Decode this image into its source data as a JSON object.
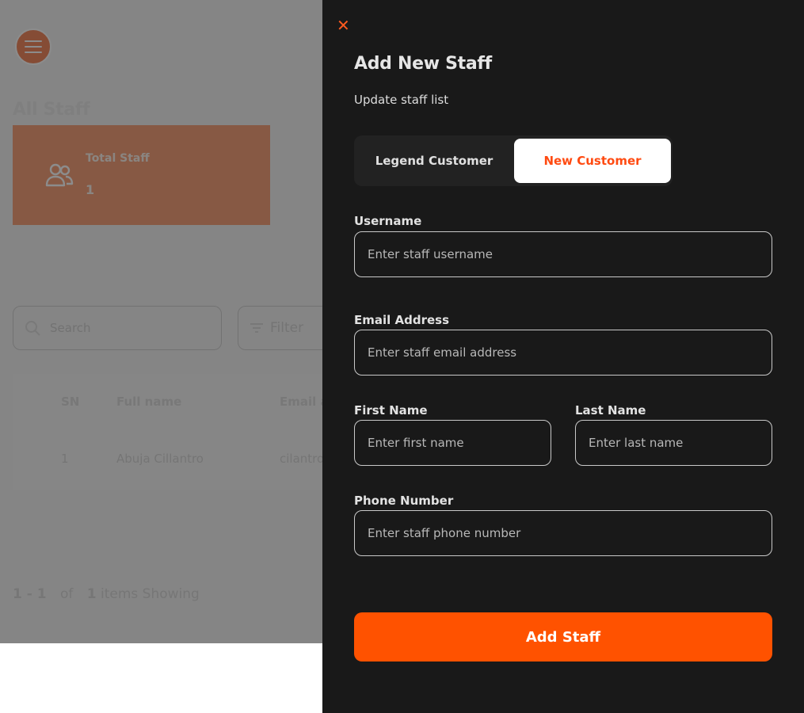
{
  "page": {
    "title": "All Staff",
    "stat": {
      "label": "Total Staff",
      "value": "1"
    },
    "search": {
      "placeholder": "Search"
    },
    "filter": {
      "label": "Filter"
    },
    "table": {
      "headers": [
        "SN",
        "Full name",
        "Email a"
      ],
      "rows": [
        {
          "sn": "1",
          "full_name": "Abuja Cillantro",
          "email": "cilantro"
        }
      ]
    },
    "pagination": {
      "range": "1 - 1",
      "of": "of",
      "total": "1",
      "suffix": "items Showing"
    }
  },
  "drawer": {
    "title": "Add New Staff",
    "subtitle": "Update staff list",
    "toggle": {
      "option_a": "Legend Customer",
      "option_b": "New Customer",
      "selected": "New Customer"
    },
    "fields": {
      "username": {
        "label": "Username",
        "placeholder": "Enter staff username"
      },
      "email": {
        "label": "Email Address",
        "placeholder": "Enter staff email address"
      },
      "first_name": {
        "label": "First Name",
        "placeholder": "Enter first name"
      },
      "last_name": {
        "label": "Last Name",
        "placeholder": "Enter last name"
      },
      "phone": {
        "label": "Phone Number",
        "placeholder": "Enter staff phone number"
      }
    },
    "submit_label": "Add Staff",
    "close_icon": "✕"
  },
  "colors": {
    "accent": "#ff5200",
    "stat_card": "#f6a37d",
    "drawer_bg": "#191919",
    "menu_button": "#f38b62"
  },
  "icons": [
    "menu-icon",
    "people-icon",
    "search-icon",
    "filter-icon",
    "close-icon"
  ]
}
